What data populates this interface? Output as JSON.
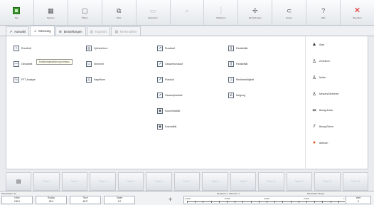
{
  "toolbar": {
    "buttons": [
      {
        "label": "Neu",
        "icon": "new-document-icon"
      },
      {
        "label": "Messen",
        "icon": "chart-measure-icon"
      },
      {
        "label": "Öffnen",
        "icon": "open-file-icon"
      },
      {
        "label": "Filter",
        "icon": "filter-icon"
      },
      {
        "label": "Speichern",
        "icon": "save-icon"
      },
      {
        "label": "",
        "icon": "zoom-icon"
      },
      {
        "label": "Markieren",
        "icon": "marker-icon"
      },
      {
        "label": "Einstellungen",
        "icon": "settings-icon"
      },
      {
        "label": "Export",
        "icon": "export-icon"
      },
      {
        "label": "Hilfe",
        "icon": "help-icon"
      },
      {
        "label": "Beenden",
        "icon": "close-icon"
      }
    ]
  },
  "tabs": [
    {
      "label": "Auswahl",
      "icon": "arrow-icon",
      "active": false,
      "enabled": true
    },
    {
      "label": "Messung",
      "icon": "measure-icon",
      "active": true,
      "enabled": true
    },
    {
      "label": "Einstellungen",
      "icon": "sliders-icon",
      "active": false,
      "enabled": true
    },
    {
      "label": "Ergebnis",
      "icon": "result-icon",
      "active": false,
      "enabled": false
    },
    {
      "label": "Merkmalliste",
      "icon": "list-icon",
      "active": false,
      "enabled": false
    }
  ],
  "main": {
    "columns": [
      [
        {
          "label": "Rundheit",
          "glyph": "○"
        },
        {
          "label": "Geradheit",
          "glyph": "—"
        },
        {
          "label": "FFT-Analyse",
          "glyph": "∿"
        }
      ],
      [
        {
          "label": "Zylinderform",
          "glyph": "◎"
        },
        {
          "label": "Ebenheit",
          "glyph": "▭"
        },
        {
          "label": "Kegelform",
          "glyph": "△"
        }
      ],
      [
        {
          "label": "Rundlauf",
          "glyph": "↗"
        },
        {
          "label": "Gesamtrundlauf",
          "glyph": "↗"
        },
        {
          "label": "Planlauf",
          "glyph": "↗"
        },
        {
          "label": "Gesamtplanlauf",
          "glyph": "↗"
        },
        {
          "label": "Konzentrizität",
          "glyph": "◉"
        },
        {
          "label": "Koaxialität",
          "glyph": "◉"
        }
      ],
      [
        {
          "label": "Parallelität",
          "glyph": "∥"
        },
        {
          "label": "Parallelität",
          "glyph": "∥"
        },
        {
          "label": "Rechtwinkligkeit",
          "glyph": "⊥"
        },
        {
          "label": "Neigung",
          "glyph": "∠"
        }
      ]
    ],
    "tooltip": "Kreisformabweichung messen",
    "side": [
      {
        "label": "Start",
        "icon": "start-icon",
        "glyph": "▲"
      },
      {
        "label": "Zentrieren",
        "icon": "center-icon",
        "glyph": "♙"
      },
      {
        "label": "Nullen",
        "icon": "zero-icon",
        "glyph": "♙"
      },
      {
        "label": "Messen/Zentrieren",
        "icon": "measure-center-icon",
        "glyph": "♙"
      },
      {
        "label": "Bezug Achse",
        "icon": "datum-axis-icon",
        "glyph": "⇹"
      },
      {
        "label": "Bezug Ebene",
        "icon": "datum-plane-icon",
        "glyph": "⫽"
      },
      {
        "label": "Abbruch",
        "icon": "stop-icon",
        "glyph": "●"
      }
    ]
  },
  "bottom_buttons": [
    "",
    "Taste 2",
    "Taste 3",
    "Taste 4",
    "Taste 5",
    "Taste 6",
    "Taste 7",
    "Taste 8",
    "Taste 9",
    "Taste 10",
    "Taste 11",
    "Taste 12",
    "Taste 13"
  ],
  "status": {
    "left": "Messstellen: 01",
    "mid": "Drehtisch: 1 / Bereich: 1",
    "right": "Messtaster: Bereit",
    "fields": [
      {
        "name": "Höhe",
        "value": "100.0"
      },
      {
        "name": "Radius",
        "value": "25.0"
      },
      {
        "name": "Tisch",
        "value": "45.0°"
      },
      {
        "name": "Taster",
        "value": "0.0"
      }
    ],
    "scale_labels": [
      "-1.000",
      "-0.500",
      "0.000",
      "0.500",
      "1.000"
    ],
    "cursor_icon": "cursor-icon",
    "right_field": {
      "name": "Wert",
      "value": "0"
    }
  }
}
